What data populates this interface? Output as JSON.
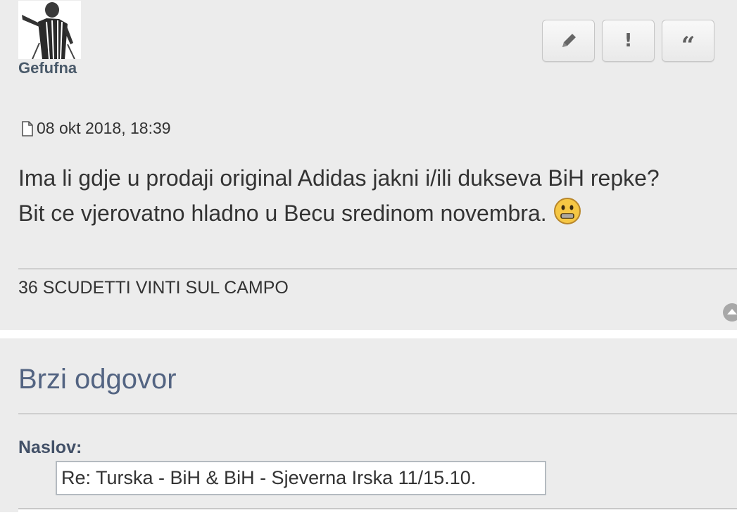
{
  "post": {
    "author": "Gefufna",
    "date": "08 okt 2018, 18:39",
    "body_line1": "Ima li gdje u prodaji original Adidas jakni i/ili dukseva BiH repke?",
    "body_line2": "Bit ce vjerovatno hladno u Becu sredinom novembra.",
    "signature": "36 SCUDETTI VINTI SUL CAMPO",
    "buttons": [
      {
        "icon": "pencil-icon",
        "glyph": "✎"
      },
      {
        "icon": "exclamation-icon",
        "glyph": "!"
      },
      {
        "icon": "quote-icon",
        "glyph": "“"
      }
    ]
  },
  "quick_reply": {
    "title": "Brzi odgovor",
    "subject_label": "Naslov:",
    "subject_value": "Re: Turska - BiH & BiH - Sjeverna Irska 11/15.10."
  },
  "colors": {
    "panel_bg": "#ececec",
    "username": "#4a5a6a",
    "heading": "#536482",
    "label": "#425067"
  }
}
